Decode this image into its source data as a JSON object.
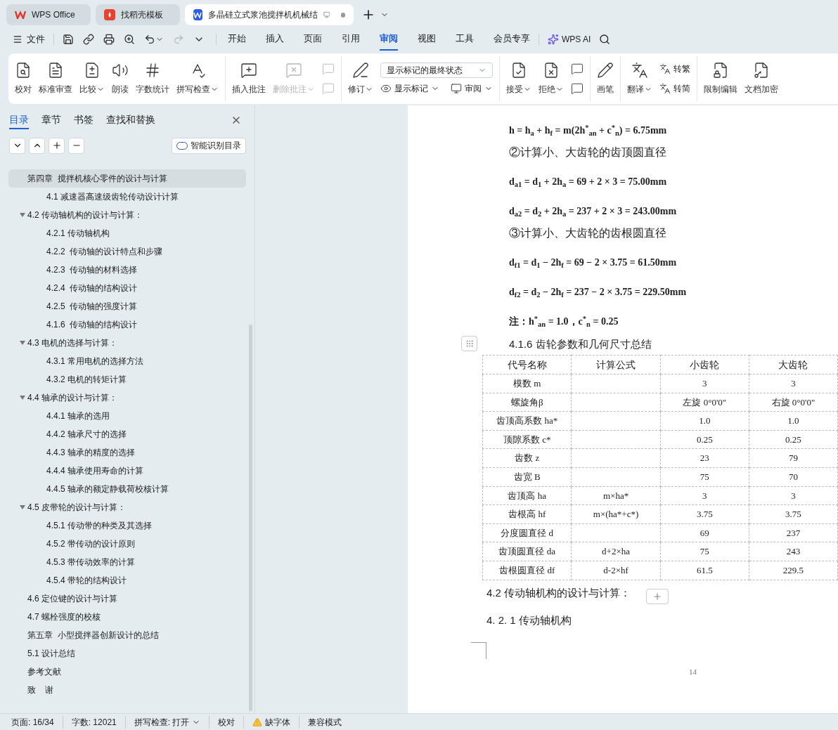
{
  "tabs": [
    {
      "label": "WPS Office",
      "kind": "home",
      "selected": false
    },
    {
      "label": "找稻壳模板",
      "kind": "template",
      "selected": false
    },
    {
      "label": "多晶硅立式浆池搅拌机机械结",
      "kind": "doc",
      "selected": true
    }
  ],
  "menu": {
    "file": "文件",
    "items": [
      {
        "label": "开始",
        "selected": false
      },
      {
        "label": "插入",
        "selected": false
      },
      {
        "label": "页面",
        "selected": false
      },
      {
        "label": "引用",
        "selected": false
      },
      {
        "label": "审阅",
        "selected": true
      },
      {
        "label": "视图",
        "selected": false
      },
      {
        "label": "工具",
        "selected": false
      },
      {
        "label": "会员专享",
        "selected": false
      }
    ],
    "ai": "WPS AI"
  },
  "ribbon": [
    {
      "items": [
        {
          "kind": "big",
          "label": "校对",
          "dropdown": false,
          "disabled": false
        },
        {
          "kind": "big",
          "label": "标准审查",
          "dropdown": false,
          "disabled": false
        },
        {
          "kind": "big",
          "label": "比较",
          "dropdown": true,
          "disabled": false
        },
        {
          "kind": "big",
          "label": "朗读",
          "dropdown": false,
          "disabled": false
        },
        {
          "kind": "big",
          "label": "字数统计",
          "dropdown": false,
          "disabled": false
        },
        {
          "kind": "big",
          "label": "拼写检查",
          "dropdown": true,
          "disabled": false
        }
      ]
    },
    {
      "items": [
        {
          "kind": "big",
          "label": "插入批注",
          "dropdown": false,
          "disabled": false
        },
        {
          "kind": "big",
          "label": "删除批注",
          "dropdown": true,
          "disabled": true
        },
        {
          "kind": "icons",
          "disabled": true
        }
      ]
    },
    {
      "items": [
        {
          "kind": "big",
          "label": "修订",
          "dropdown": true,
          "disabled": false
        },
        {
          "kind": "select",
          "value": "显示标记的最终状态",
          "rows": [
            {
              "label": "显示标记",
              "dropdown": true
            },
            {
              "label": "审阅",
              "dropdown": true
            }
          ]
        }
      ]
    },
    {
      "items": [
        {
          "kind": "big",
          "label": "接受",
          "dropdown": true,
          "disabled": false
        },
        {
          "kind": "big",
          "label": "拒绝",
          "dropdown": true,
          "disabled": false
        },
        {
          "kind": "icons",
          "disabled": false
        }
      ]
    },
    {
      "items": [
        {
          "kind": "big",
          "label": "画笔",
          "dropdown": false,
          "disabled": false
        }
      ]
    },
    {
      "items": [
        {
          "kind": "big",
          "label": "翻译",
          "dropdown": true,
          "disabled": false
        },
        {
          "kind": "rows",
          "rows": [
            {
              "label": "转繁",
              "dropdown": false
            },
            {
              "label": "转简",
              "dropdown": false
            }
          ]
        }
      ]
    },
    {
      "items": [
        {
          "kind": "big",
          "label": "限制编辑",
          "dropdown": false,
          "disabled": false
        },
        {
          "kind": "big",
          "label": "文档加密",
          "dropdown": false,
          "disabled": false
        }
      ]
    }
  ],
  "nav": {
    "tabs": [
      {
        "label": "目录",
        "selected": true
      },
      {
        "label": "章节",
        "selected": false
      },
      {
        "label": "书签",
        "selected": false
      },
      {
        "label": "查找和替换",
        "selected": false
      }
    ],
    "smart_button": "智能识别目录",
    "toc": [
      {
        "label": "第四章  搅拌机核心零件的设计与计算",
        "selected": true,
        "children": [
          {
            "label": "4.1 减速器高速级齿轮传动设计计算",
            "selected": false
          }
        ]
      },
      {
        "label": "4.2 传动轴机构的设计与计算：",
        "selected": false,
        "expanded": true,
        "children": [
          {
            "label": "4.2.1 传动轴机构",
            "selected": false
          },
          {
            "label": "4.2.2  传动轴的设计特点和步骤",
            "selected": false
          },
          {
            "label": "4.2.3  传动轴的材料选择",
            "selected": false
          },
          {
            "label": "4.2.4  传动轴的结构设计",
            "selected": false
          },
          {
            "label": "4.2.5  传动轴的强度计算",
            "selected": false
          },
          {
            "label": "4.1.6  传动轴的结构设计",
            "selected": false
          }
        ]
      },
      {
        "label": "4.3 电机的选择与计算：",
        "selected": false,
        "expanded": true,
        "children": [
          {
            "label": "4.3.1 常用电机的选择方法",
            "selected": false
          },
          {
            "label": "4.3.2 电机的转矩计算",
            "selected": false
          }
        ]
      },
      {
        "label": "4.4 轴承的设计与计算：",
        "selected": false,
        "expanded": true,
        "children": [
          {
            "label": "4.4.1 轴承的选用",
            "selected": false
          },
          {
            "label": "4.4.2 轴承尺寸的选择",
            "selected": false
          },
          {
            "label": "4.4.3 轴承的精度的选择",
            "selected": false
          },
          {
            "label": "4.4.4 轴承使用寿命的计算",
            "selected": false
          },
          {
            "label": "4.4.5 轴承的额定静载荷校核计算",
            "selected": false
          }
        ]
      },
      {
        "label": "4.5 皮带轮的设计与计算：",
        "selected": false,
        "expanded": true,
        "children": [
          {
            "label": "4.5.1 传动带的种类及其选择",
            "selected": false
          },
          {
            "label": "4.5.2 带传动的设计原则",
            "selected": false
          },
          {
            "label": "4.5.3 带传动效率的计算",
            "selected": false
          },
          {
            "label": "4.5.4 带轮的结构设计",
            "selected": false
          }
        ]
      },
      {
        "label": "4.6 定位键的设计与计算",
        "selected": false
      },
      {
        "label": "4.7 螺栓强度的校核",
        "selected": false
      },
      {
        "label": "第五章  小型搅拌器创新设计的总结",
        "selected": false
      },
      {
        "label": "5.1 设计总结",
        "selected": false
      },
      {
        "label": "参考文献",
        "selected": false
      },
      {
        "label": "致    谢",
        "selected": false
      }
    ]
  },
  "document": {
    "blocks": [
      {
        "kind": "formula",
        "text": "h = h$_{a}$ + h$_{f}$ = m(2h$^{*}$$_{an}$ + c$^{*}$$_{n}$) = 6.75mm"
      },
      {
        "kind": "text",
        "text": "②计算小、大齿轮的齿顶圆直径"
      },
      {
        "kind": "formula",
        "text": "d$_{a1}$ = d$_{1}$ + 2h$_{a}$ = 69 + 2 × 3 = 75.00mm"
      },
      {
        "kind": "formula",
        "text": "d$_{a2}$ = d$_{2}$ + 2h$_{a}$ = 237 + 2 × 3 = 243.00mm"
      },
      {
        "kind": "text",
        "text": "③计算小、大齿轮的齿根圆直径"
      },
      {
        "kind": "formula",
        "text": "d$_{f1}$ = d$_{1}$ − 2h$_{f}$ = 69 − 2 × 3.75 = 61.50mm"
      },
      {
        "kind": "formula",
        "text": "d$_{f2}$ = d$_{2}$ − 2h$_{f}$ = 237 − 2 × 3.75 = 229.50mm"
      },
      {
        "kind": "formula",
        "text": "注：h$^{*}$$_{an}$ = 1.0，c$^{*}$$_{n}$ = 0.25"
      },
      {
        "kind": "heading",
        "text": "4.1.6 齿轮参数和几何尺寸总结"
      }
    ],
    "table": {
      "columns": [
        "代号名称",
        "计算公式",
        "小齿轮",
        "大齿轮"
      ],
      "rows": [
        [
          "模数 m",
          "",
          "3",
          "3"
        ],
        [
          "螺旋角β",
          "",
          "左旋 0°0'0\"",
          "右旋 0°0'0\""
        ],
        [
          "齿顶高系数 ha*",
          "",
          "1.0",
          "1.0"
        ],
        [
          "顶隙系数 c*",
          "",
          "0.25",
          "0.25"
        ],
        [
          "齿数 z",
          "",
          "23",
          "79"
        ],
        [
          "齿宽 B",
          "",
          "75",
          "70"
        ],
        [
          "齿顶高 ha",
          "m×ha*",
          "3",
          "3"
        ],
        [
          "齿根高 hf",
          "m×(ha*+c*)",
          "3.75",
          "3.75"
        ],
        [
          "分度圆直径 d",
          "",
          "69",
          "237"
        ],
        [
          "齿顶圆直径 da",
          "d+2×ha",
          "75",
          "243"
        ],
        [
          "齿根圆直径 df",
          "d-2×hf",
          "61.5",
          "229.5"
        ]
      ]
    },
    "after": [
      {
        "kind": "section",
        "text": "4.2 传动轴机构的设计与计算："
      },
      {
        "kind": "subsection",
        "text": "4. 2. 1 传动轴机构"
      }
    ],
    "page_number": "14"
  },
  "status_bar": [
    {
      "kind": "text",
      "label": "页面: 16/34"
    },
    {
      "kind": "text",
      "label": "字数: 12021"
    },
    {
      "kind": "dropdown",
      "label": "拼写检查: 打开"
    },
    {
      "kind": "text",
      "label": "校对"
    },
    {
      "kind": "warning",
      "label": "缺字体"
    },
    {
      "kind": "text",
      "label": "兼容模式"
    }
  ]
}
